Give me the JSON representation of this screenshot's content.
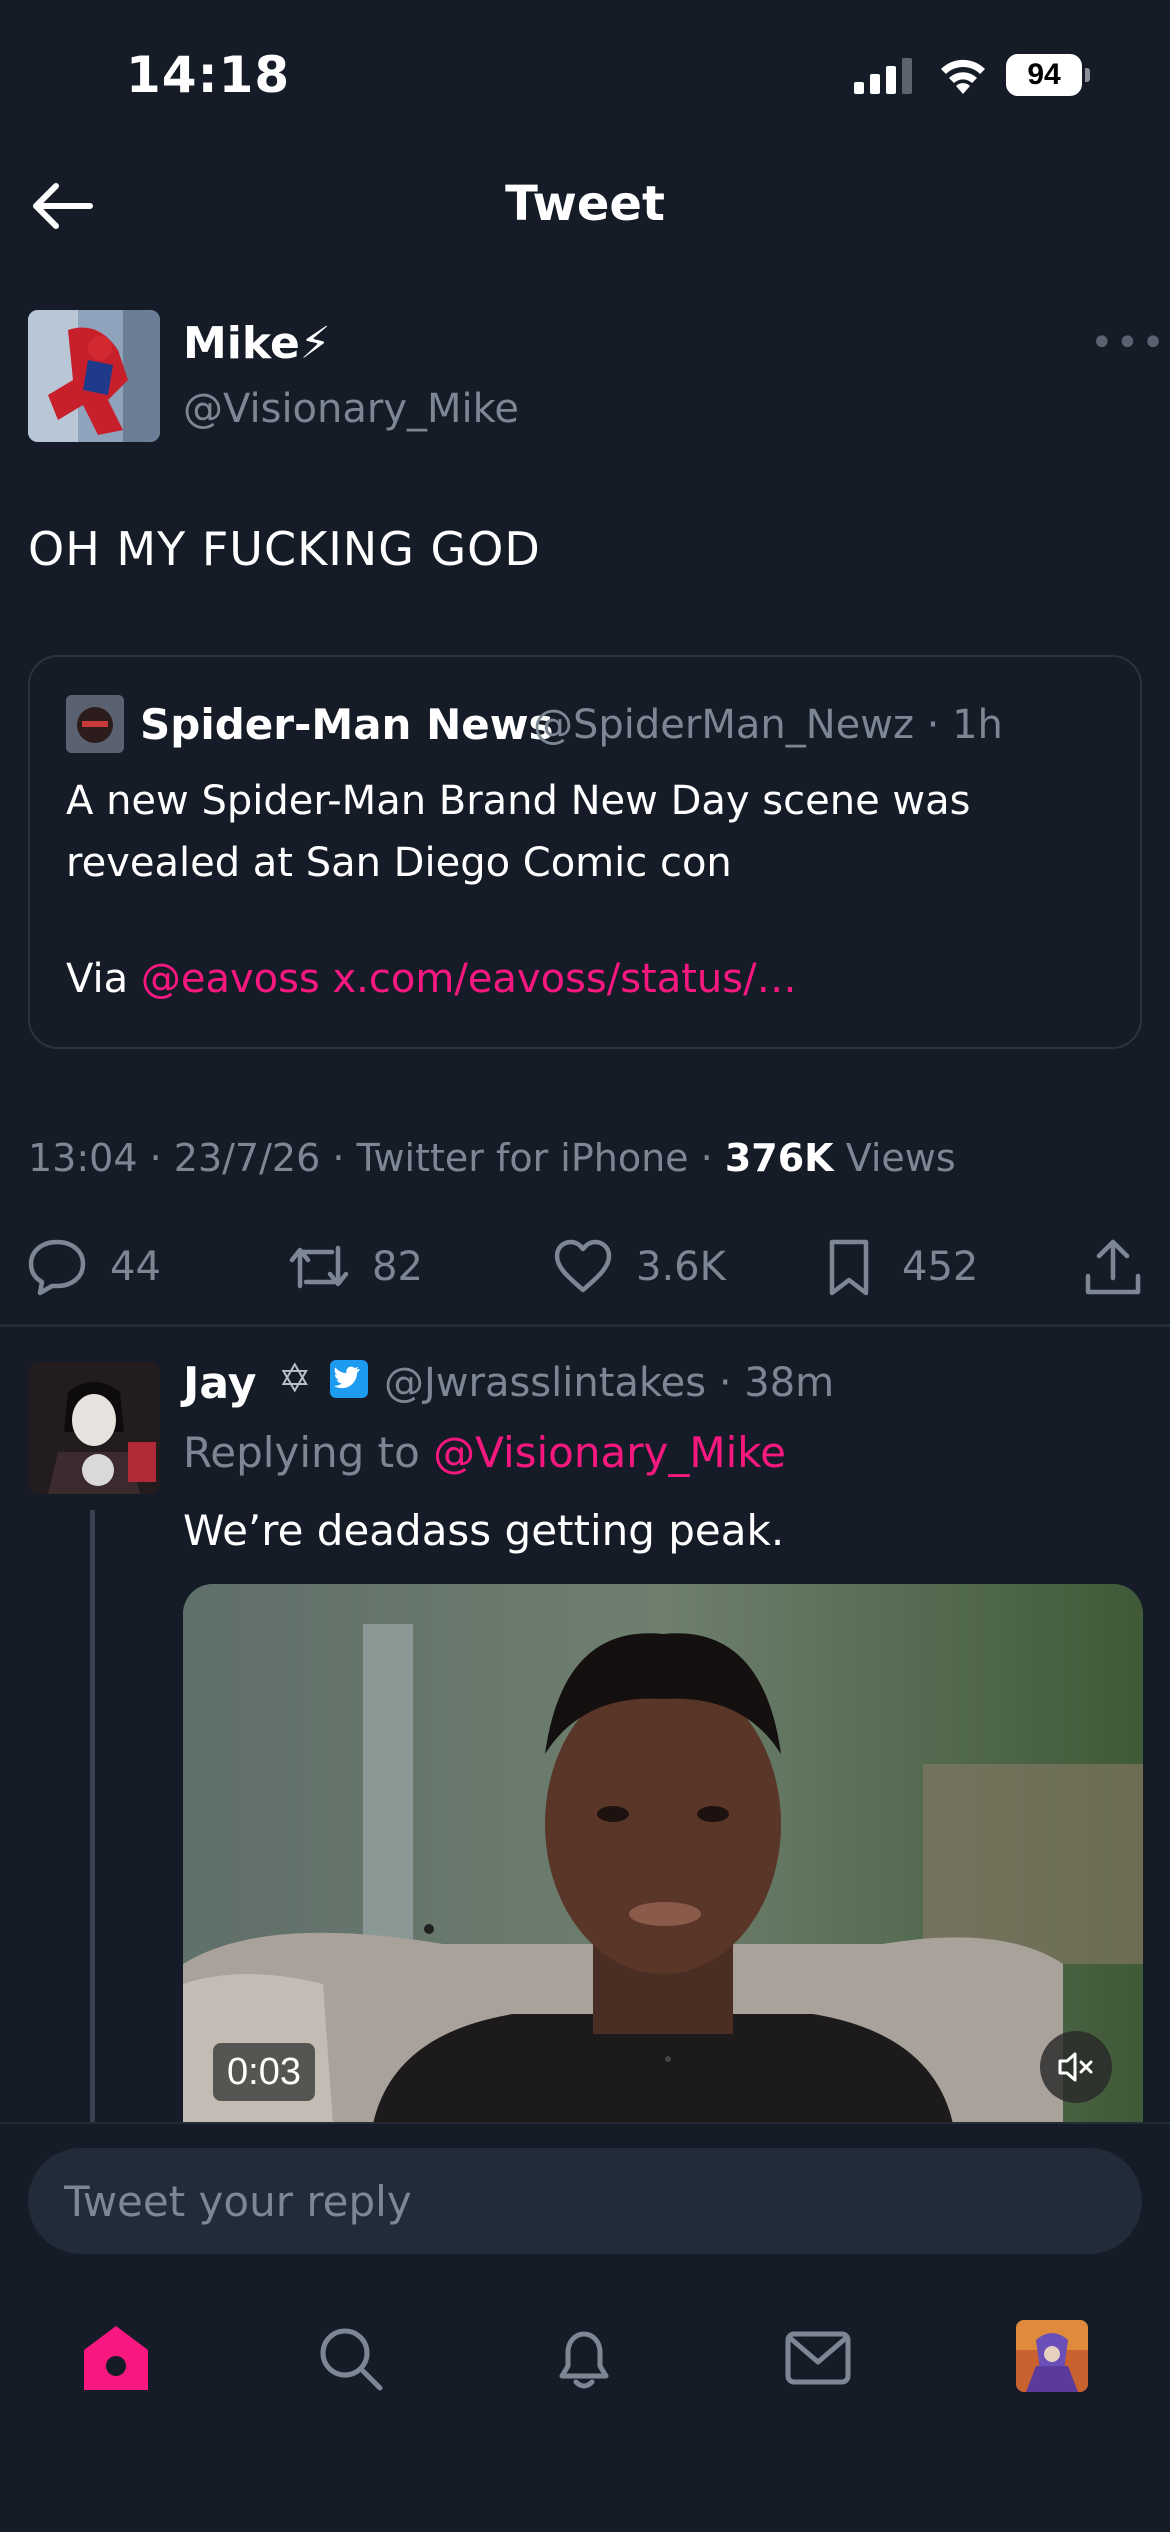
{
  "status_bar": {
    "time": "14:18",
    "battery": "94"
  },
  "header": {
    "title": "Tweet"
  },
  "tweet": {
    "author_name": "Mike⚡",
    "author_handle": "@Visionary_Mike",
    "text": "OH MY FUCKING GOD",
    "quote": {
      "name": "Spider-Man News",
      "handle_time": "@SpiderMan_Newz · 1h",
      "text": "A new Spider-Man Brand New Day scene was revealed at San Diego Comic con",
      "via_prefix": "Via ",
      "via_mention": "@eavoss",
      "via_link": "x.com/eavoss/status/…"
    },
    "meta": {
      "time": "13:04",
      "date": "23/7/26",
      "client": "Twitter for iPhone",
      "views_count": "376K",
      "views_label": "Views"
    },
    "actions": {
      "replies": "44",
      "retweets": "82",
      "likes": "3.6K",
      "bookmarks": "452"
    }
  },
  "reply": {
    "name": "Jay",
    "star": "✡",
    "handle_time": "@Jwrasslintakes · 38m",
    "replying_prefix": "Replying to ",
    "replying_to": "@Visionary_Mike",
    "text": "We’re deadass getting peak.",
    "video_time": "0:03"
  },
  "composer": {
    "placeholder": "Tweet your reply"
  },
  "colors": {
    "accent": "#f91880",
    "background": "#151c28",
    "muted": "#7d8794",
    "verified": "#1d9bf0"
  }
}
